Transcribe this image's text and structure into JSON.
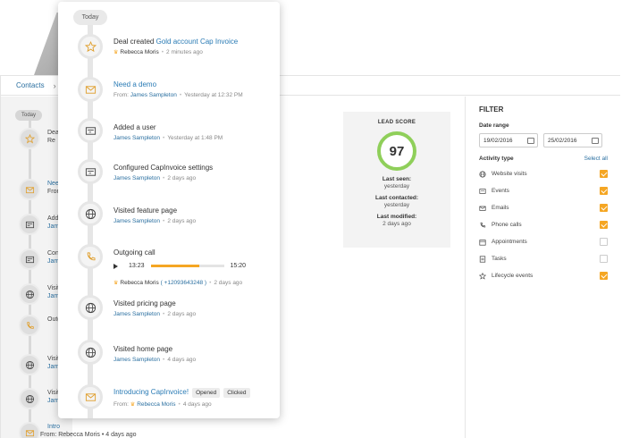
{
  "breadcrumb": {
    "root": "Contacts",
    "chevron": "›"
  },
  "background_timeline": {
    "today": "Today",
    "items": [
      {
        "text": "Deal",
        "sub": "Re"
      },
      {
        "text": "Need",
        "sub": "From:"
      },
      {
        "text": "Adde",
        "sub": "Jam"
      },
      {
        "text": "Conf",
        "sub": "Jam"
      },
      {
        "text": "Visit",
        "sub": "Jam"
      },
      {
        "text": "Outg",
        "sub": ""
      },
      {
        "text": "Visit",
        "sub": "Jam"
      },
      {
        "text": "Visit",
        "sub": "Jam"
      },
      {
        "text": "Intro",
        "sub": "From: Rebecca Moris • 4 days ago"
      }
    ]
  },
  "lead_score": {
    "title": "LEAD SCORE",
    "score": "97",
    "last_seen_label": "Last seen:",
    "last_seen_value": "yesterday",
    "last_contacted_label": "Last contacted:",
    "last_contacted_value": "yesterday",
    "last_modified_label": "Last modified:",
    "last_modified_value": "2 days ago"
  },
  "filter": {
    "title": "FILTER",
    "date_range_label": "Date range",
    "date_from": "19/02/2016",
    "date_to": "25/02/2016",
    "activity_type_label": "Activity type",
    "select_all": "Select all",
    "activities": [
      {
        "label": "Website visits",
        "icon": "globe-icon",
        "checked": true
      },
      {
        "label": "Events",
        "icon": "event-icon",
        "checked": true
      },
      {
        "label": "Emails",
        "icon": "envelope-icon",
        "checked": true
      },
      {
        "label": "Phone calls",
        "icon": "phone-icon",
        "checked": true
      },
      {
        "label": "Appointments",
        "icon": "calendar-icon",
        "checked": false
      },
      {
        "label": "Tasks",
        "icon": "tasks-icon",
        "checked": false
      },
      {
        "label": "Lifecycle events",
        "icon": "star-icon",
        "checked": true
      }
    ]
  },
  "timeline": {
    "today": "Today",
    "events": [
      {
        "icon": "star-icon",
        "title_prefix": "Deal created ",
        "title_link": "Gold account Cap Invoice",
        "crown": "♛",
        "who": "Rebecca Moris",
        "sep": "•",
        "when": "2 minutes ago"
      },
      {
        "icon": "envelope-icon",
        "title": "Need a demo",
        "from": "From:",
        "who": "James Sampleton",
        "sep": "•",
        "when": "Yesterday at 12:32 PM"
      },
      {
        "icon": "user-card-icon",
        "title": "Added a user",
        "who": "James Sampleton",
        "sep": "•",
        "when": "Yesterday at 1:48 PM"
      },
      {
        "icon": "settings-card-icon",
        "title": "Configured CapInvoice settings",
        "who": "James Sampleton",
        "sep": "•",
        "when": "2 days ago"
      },
      {
        "icon": "globe-icon",
        "title": "Visited feature page",
        "who": "James Sampleton",
        "sep": "•",
        "when": "2 days ago"
      },
      {
        "icon": "phone-icon",
        "title": "Outgoing call",
        "time_current": "13:23",
        "time_total": "15:20",
        "progress": 0.66,
        "crown": "♛",
        "who": "Rebecca Moris",
        "phone": "( +12093643248 )",
        "sep": "•",
        "when": "2 days ago"
      },
      {
        "icon": "globe-icon",
        "title": "Visited pricing page",
        "who": "James Sampleton",
        "sep": "•",
        "when": "2 days ago"
      },
      {
        "icon": "globe-icon",
        "title": "Visited home  page",
        "who": "James Sampleton",
        "sep": "•",
        "when": "4 days ago"
      },
      {
        "icon": "envelope-icon",
        "title": "Introducing CapInvoice!",
        "badge_opened": "Opened",
        "badge_clicked": "Clicked",
        "from": "From:",
        "crown": "♛",
        "who": "Rebecca Moris",
        "sep": "•",
        "when": "4 days ago"
      }
    ]
  },
  "colors": {
    "accent": "#f5a623",
    "link": "#2a7bb5",
    "score_ring": "#8fcf5a"
  }
}
